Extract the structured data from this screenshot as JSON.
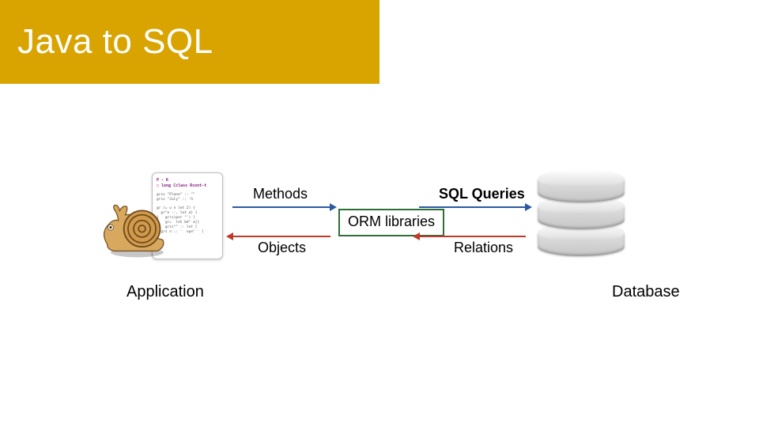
{
  "title": "Java to SQL",
  "labels": {
    "methods": "Methods",
    "sql_queries": "SQL Queries",
    "objects": "Objects",
    "relations": "Relations",
    "application": "Application",
    "database": "Database"
  },
  "orm_box": "ORM\nlibraries"
}
